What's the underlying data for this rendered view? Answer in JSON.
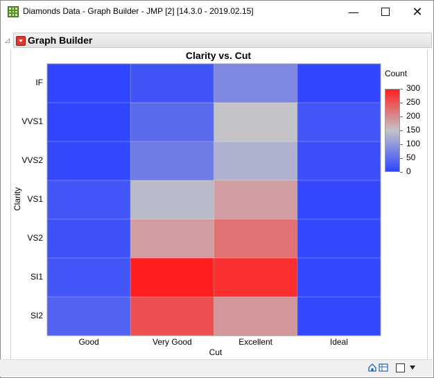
{
  "window": {
    "title": "Diamonds Data - Graph Builder - JMP [2] [14.3.0 - 2019.02.15]",
    "minimize_glyph": "—",
    "close_glyph": "✕"
  },
  "report": {
    "title": "Graph Builder",
    "outline_glyph": "◿"
  },
  "chart_data": {
    "type": "heatmap",
    "title": "Clarity vs. Cut",
    "xlabel": "Cut",
    "ylabel": "Clarity",
    "x_categories": [
      "Good",
      "Very Good",
      "Excellent",
      "Ideal"
    ],
    "y_categories": [
      "IF",
      "VVS1",
      "VVS2",
      "VS1",
      "VS2",
      "SI1",
      "SI2"
    ],
    "values": [
      [
        0,
        18,
        80,
        2
      ],
      [
        2,
        45,
        150,
        20
      ],
      [
        5,
        65,
        130,
        12
      ],
      [
        20,
        140,
        185,
        5
      ],
      [
        15,
        185,
        225,
        5
      ],
      [
        20,
        300,
        285,
        5
      ],
      [
        35,
        255,
        190,
        5
      ]
    ],
    "legend": {
      "title": "Count",
      "min": 0,
      "max": 300,
      "ticks": [
        300,
        250,
        200,
        150,
        100,
        50,
        0
      ],
      "colors": {
        "low": "#2f45ff",
        "mid": "#c3c3c7",
        "high": "#ff1f1f"
      }
    },
    "grid": true
  },
  "statusbar": {
    "icons": [
      "home-icon",
      "grid-icon",
      "selection-box-icon",
      "dropdown-arrow-icon"
    ]
  }
}
